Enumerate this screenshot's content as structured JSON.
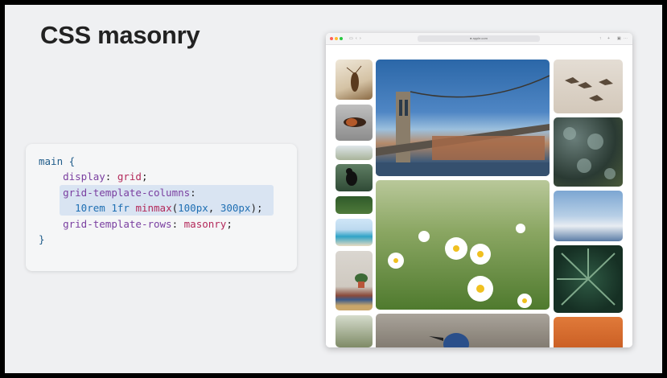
{
  "slide": {
    "title": "CSS masonry"
  },
  "code": {
    "line1": "main {",
    "line2_prop": "display",
    "line2_val": "grid",
    "line3_prop": "grid-template-columns",
    "line4_num1": "10rem",
    "line4_num2": "1fr",
    "line4_fn": "minmax",
    "line4_arg1": "100px",
    "line4_arg2": "300px",
    "line5_prop": "grid-template-rows",
    "line5_val": "masonry",
    "line6": "}"
  },
  "browser": {
    "url": "● apple.com",
    "icons": [
      "sidebar-icon",
      "back-icon",
      "forward-icon",
      "share-icon",
      "new-tab-icon",
      "tabs-icon"
    ]
  },
  "photos": {
    "column_left": [
      "insect-photo",
      "caterpillar-photo",
      "deer-photo",
      "crow-photo",
      "forest-photo",
      "beach-photo",
      "bookshelf-photo",
      "bird-branch-photo"
    ],
    "column_center": [
      "brooklyn-bridge-photo",
      "daisies-photo",
      "blue-jay-photo"
    ],
    "column_right": [
      "pelicans-photo",
      "bokeh-photo",
      "snowy-mountain-photo",
      "succulent-photo",
      "orange-wall-photo"
    ]
  },
  "colors": {
    "background": "#eff0f2",
    "accent_highlight": "#d9e4f2",
    "traffic_red": "#fe5f57",
    "traffic_yellow": "#febc2e",
    "traffic_green": "#28c840"
  }
}
